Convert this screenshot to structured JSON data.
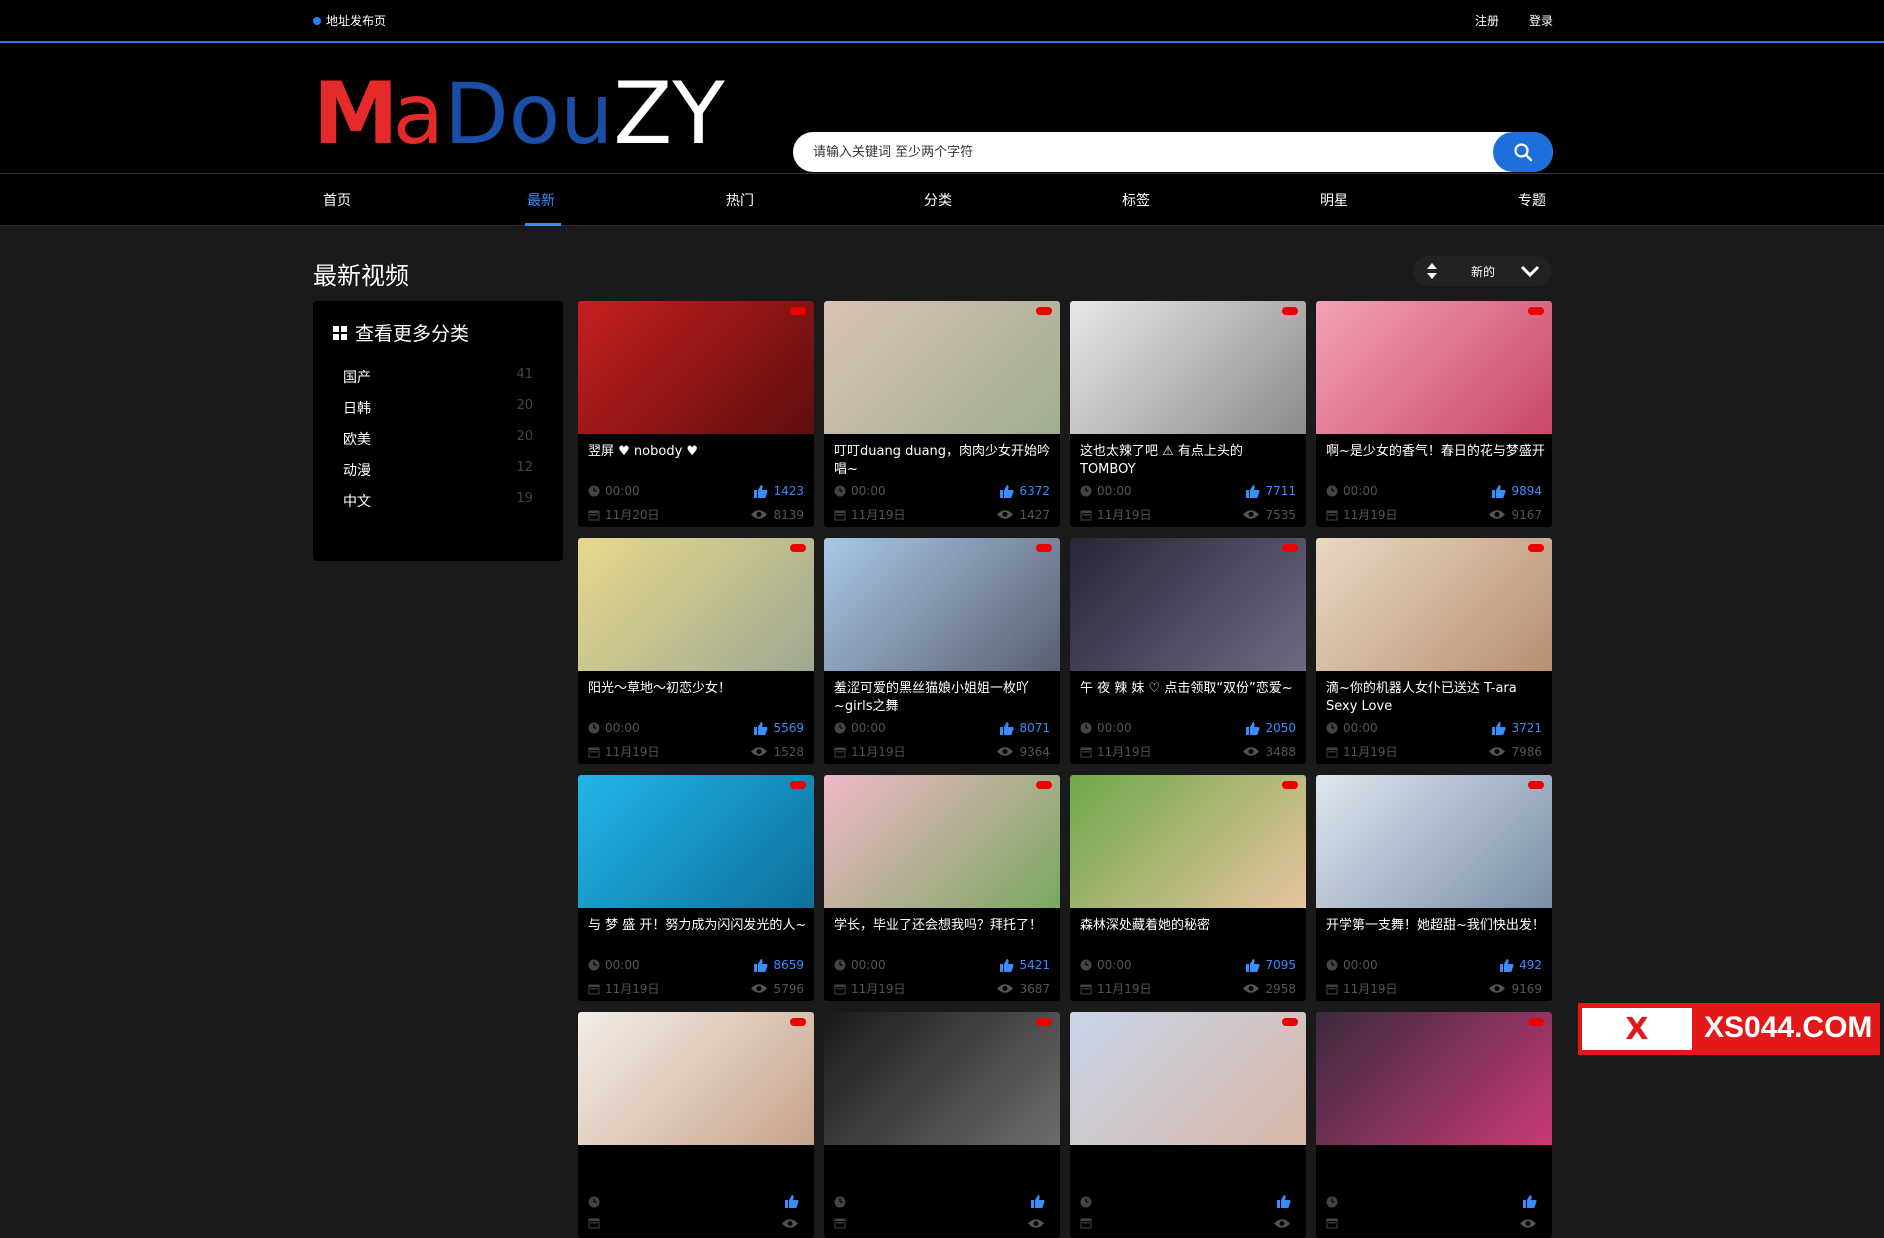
{
  "topbar": {
    "notice": "地址发布页",
    "register": "注册",
    "login": "登录"
  },
  "logo": {
    "part1": "M",
    "part2": "a",
    "part3": "Dou",
    "part4": "ZY"
  },
  "search": {
    "placeholder": "请输入关键词 至少两个字符"
  },
  "nav": [
    "首页",
    "最新",
    "热门",
    "分类",
    "标签",
    "明星",
    "专题"
  ],
  "nav_active": "最新",
  "page_title": "最新视频",
  "sort": {
    "value": "新的"
  },
  "sidebar": {
    "title": "查看更多分类",
    "categories": [
      {
        "name": "国产",
        "count": "41"
      },
      {
        "name": "日韩",
        "count": "20"
      },
      {
        "name": "欧美",
        "count": "20"
      },
      {
        "name": "动漫",
        "count": "12"
      },
      {
        "name": "中文",
        "count": "19"
      }
    ]
  },
  "videos": [
    {
      "title": "翌屏 ♥ nobody ♥",
      "duration": "00:00",
      "likes": "1423",
      "date": "11月20日",
      "views": "8139",
      "color1": "#c61f1f",
      "color2": "#5e0d0d"
    },
    {
      "title": "叮叮duang duang，肉肉少女开始吟唱~",
      "duration": "00:00",
      "likes": "6372",
      "date": "11月19日",
      "views": "1427",
      "color1": "#d9c3b6",
      "color2": "#9fae8e"
    },
    {
      "title": "这也太辣了吧 ⚠ 有点上头的 TOMBOY",
      "duration": "00:00",
      "likes": "7711",
      "date": "11月19日",
      "views": "7535",
      "color1": "#e8e8e8",
      "color2": "#8c8c8c"
    },
    {
      "title": "啊~是少女的香气！春日的花与梦盛开",
      "duration": "00:00",
      "likes": "9894",
      "date": "11月19日",
      "views": "9167",
      "color1": "#f3a2b6",
      "color2": "#c9476a"
    },
    {
      "title": "阳光～草地～初恋少女！",
      "duration": "00:00",
      "likes": "5569",
      "date": "11月19日",
      "views": "1528",
      "color1": "#e6d98c",
      "color2": "#9fa892"
    },
    {
      "title": "羞涩可爱的黑丝猫娘小姐姐一枚吖~girls之舞",
      "duration": "00:00",
      "likes": "8071",
      "date": "11月19日",
      "views": "9364",
      "color1": "#a8c8e6",
      "color2": "#5b5f72"
    },
    {
      "title": "午 夜 辣 妹 ♡ 点击领取“双份”恋爱~",
      "duration": "00:00",
      "likes": "2050",
      "date": "11月19日",
      "views": "3488",
      "color1": "#2a2438",
      "color2": "#6e6a80"
    },
    {
      "title": "滴~你的机器人女仆已送达 T-ara Sexy Love",
      "duration": "00:00",
      "likes": "3721",
      "date": "11月19日",
      "views": "7986",
      "color1": "#e9d8c2",
      "color2": "#b88f72"
    },
    {
      "title": "与 梦 盛 开！努力成为闪闪发光的人~",
      "duration": "00:00",
      "likes": "8659",
      "date": "11月19日",
      "views": "5796",
      "color1": "#22b6e8",
      "color2": "#0d6f9c"
    },
    {
      "title": "学长，毕业了还会想我吗？拜托了！",
      "duration": "00:00",
      "likes": "5421",
      "date": "11月19日",
      "views": "3687",
      "color1": "#f0b8c8",
      "color2": "#7aa860"
    },
    {
      "title": "森林深处藏着她的秘密",
      "duration": "00:00",
      "likes": "7095",
      "date": "11月19日",
      "views": "2958",
      "color1": "#6ea84a",
      "color2": "#e8c4a0"
    },
    {
      "title": "开学第一支舞！她超甜~我们快出发！",
      "duration": "00:00",
      "likes": "492",
      "date": "11月19日",
      "views": "9169",
      "color1": "#dfe6ee",
      "color2": "#7a8ea8"
    },
    {
      "title": "",
      "duration": "",
      "likes": "",
      "date": "",
      "views": "",
      "color1": "#f2eee8",
      "color2": "#c9a38a"
    },
    {
      "title": "",
      "duration": "",
      "likes": "",
      "date": "",
      "views": "",
      "color1": "#1a1a1a",
      "color2": "#6d6d6d"
    },
    {
      "title": "",
      "duration": "",
      "likes": "",
      "date": "",
      "views": "",
      "color1": "#c8d4e8",
      "color2": "#d8b8a8"
    },
    {
      "title": "",
      "duration": "",
      "likes": "",
      "date": "",
      "views": "",
      "color1": "#3a2a3e",
      "color2": "#c83a78"
    }
  ],
  "ad": {
    "left_text": "X",
    "right_text": "XS044.COM"
  }
}
